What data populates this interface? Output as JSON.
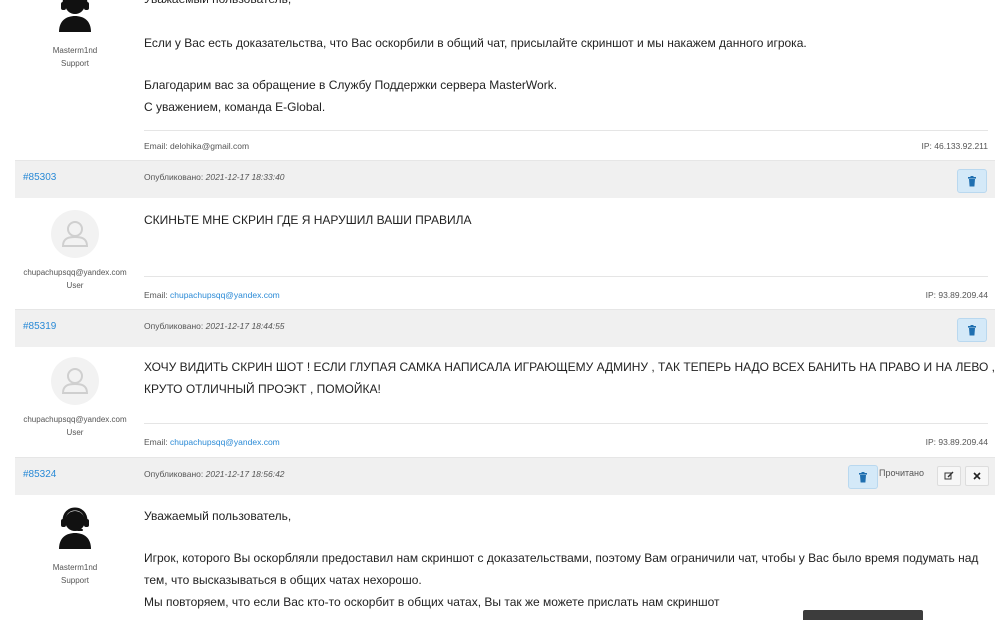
{
  "thread": {
    "reply1": {
      "author_name": "Masterm1nd",
      "author_role": "Support",
      "greeting": "Уважаемый пользователь,",
      "line1": "Если у Вас есть доказательства, что Вас оскорбили в общий чат, присылайте скриншот и мы накажем данного игрока.",
      "line2": "Благодарим вас за обращение в Службу Поддержки сервера  MasterWork.",
      "line3": "С уважением, команда E-Global.",
      "email_label": "Email:",
      "email": "delohika@gmail.com",
      "ip": "IP: 46.133.92.211"
    },
    "post1": {
      "id": "#85303",
      "published_label": "Опубликовано:",
      "date": "2021-12-17 18:33:40",
      "author_name": "chupachupsqq@yandex.com",
      "author_role": "User",
      "text": " СКИНЬТЕ МНЕ СКРИН ГДЕ Я НАРУШИЛ ВАШИ ПРАВИЛА",
      "email_label": "Email:",
      "email": "chupachupsqq@yandex.com",
      "ip": "IP: 93.89.209.44"
    },
    "post2": {
      "id": "#85319",
      "published_label": "Опубликовано:",
      "date": "2021-12-17 18:44:55",
      "author_name": "chupachupsqq@yandex.com",
      "author_role": "User",
      "text1": "ХОЧУ ВИДИТЬ СКРИН ШОТ ! ЕСЛИ ГЛУПАЯ САМКА НАПИСАЛА ИГРАЮЩЕМУ АДМИНУ  , ТАК ТЕПЕРЬ НАДО ВСЕХ БАНИТЬ НА ПРАВО И НА ЛЕВО ,",
      "text2": "КРУТО ОТЛИЧНЫЙ ПРОЭКТ , ПОМОЙКА!",
      "email_label": "Email:",
      "email": "chupachupsqq@yandex.com",
      "ip": "IP: 93.89.209.44"
    },
    "post3": {
      "id": "#85324",
      "published_label": "Опубликовано:",
      "date": "2021-12-17 18:56:42",
      "read_label": "Прочитано",
      "author_name": "Masterm1nd",
      "author_role": "Support",
      "greeting": "Уважаемый пользователь,",
      "line1": "Игрок, которого Вы оскорбляли предоставил нам скриншот с доказательствами, поэтому Вам ограничили чат, чтобы у Вас было время подумать над",
      "line2": "тем, что высказываться в общих чатах нехорошо.",
      "line3": "Мы повторяем, что если Вас кто-то оскорбит в общих чатах, Вы так же можете прислать нам скриншот"
    }
  },
  "icons": {
    "delete": "trash-icon",
    "edit": "pencil-icon",
    "close": "close-icon",
    "support_avatar": "headset-agent-icon",
    "user_avatar": "default-user-icon"
  },
  "colors": {
    "link": "#2a8ad6",
    "bar": "#f0f0f0",
    "delete_btn": "#d4e9f8"
  }
}
